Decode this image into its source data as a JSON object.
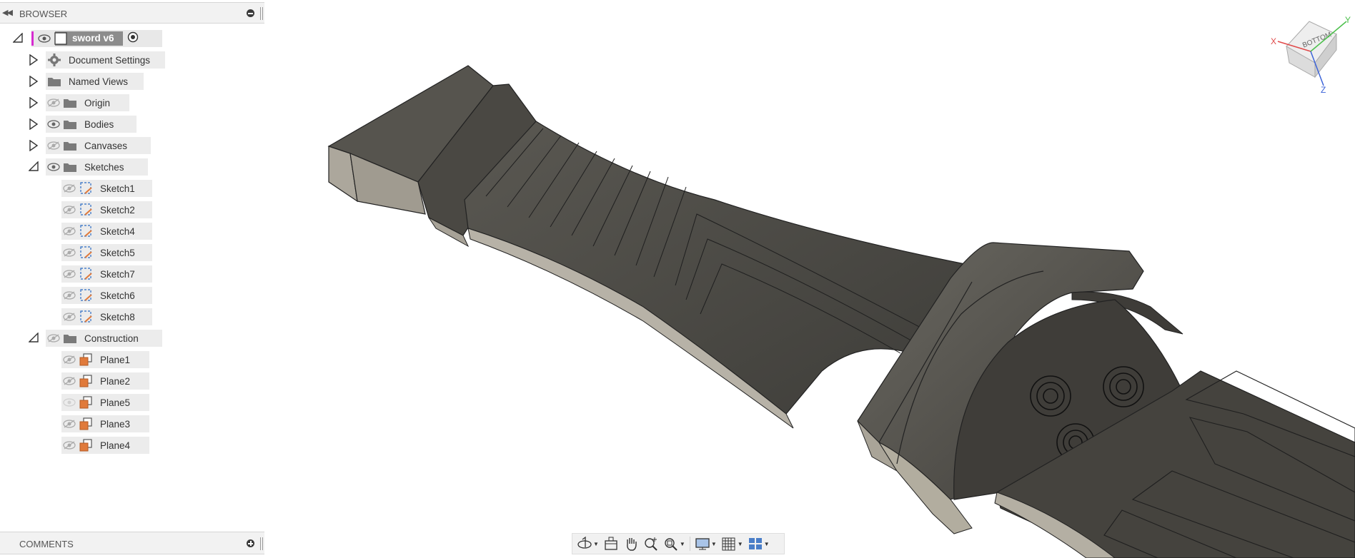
{
  "browser": {
    "title": "BROWSER",
    "root": {
      "label": "sword v6"
    },
    "items": [
      {
        "label": "Document Settings"
      },
      {
        "label": "Named Views"
      },
      {
        "label": "Origin"
      },
      {
        "label": "Bodies"
      },
      {
        "label": "Canvases"
      },
      {
        "label": "Sketches"
      },
      {
        "label": "Construction"
      }
    ],
    "sketches": [
      {
        "label": "Sketch1"
      },
      {
        "label": "Sketch2"
      },
      {
        "label": "Sketch4"
      },
      {
        "label": "Sketch5"
      },
      {
        "label": "Sketch7"
      },
      {
        "label": "Sketch6"
      },
      {
        "label": "Sketch8"
      }
    ],
    "planes": [
      {
        "label": "Plane1"
      },
      {
        "label": "Plane2"
      },
      {
        "label": "Plane5"
      },
      {
        "label": "Plane3"
      },
      {
        "label": "Plane4"
      }
    ]
  },
  "comments": {
    "title": "COMMENTS"
  },
  "viewcube": {
    "face_label": "BOTTOM",
    "axis_x": "X",
    "axis_y": "Y",
    "axis_z": "Z"
  },
  "colors": {
    "accent": "#d62bd0",
    "model_dark": "#4e4c47",
    "model_light": "#aaa59a",
    "plane_orange": "#e07a3b"
  }
}
